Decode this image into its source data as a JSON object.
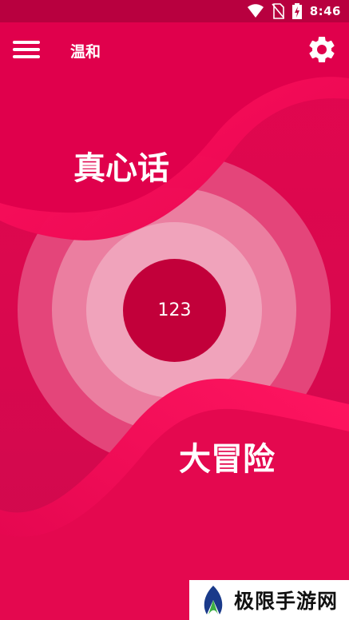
{
  "status_bar": {
    "time": "8:46",
    "icons": [
      "wifi-icon",
      "no-sim-icon",
      "battery-charging-icon"
    ]
  },
  "app_bar": {
    "title": "温和",
    "menu_icon": "hamburger-menu-icon",
    "settings_icon": "gear-icon"
  },
  "main": {
    "truth_label": "真心话",
    "dare_label": "大冒险",
    "center_number": "123"
  },
  "colors": {
    "primary": "#d80a4f",
    "status_bar": "#b8003f",
    "center": "#c2003a",
    "accent_wave": "#ff0f5a"
  },
  "watermark": {
    "text": "极限手游网",
    "logo": "leaf-logo"
  }
}
